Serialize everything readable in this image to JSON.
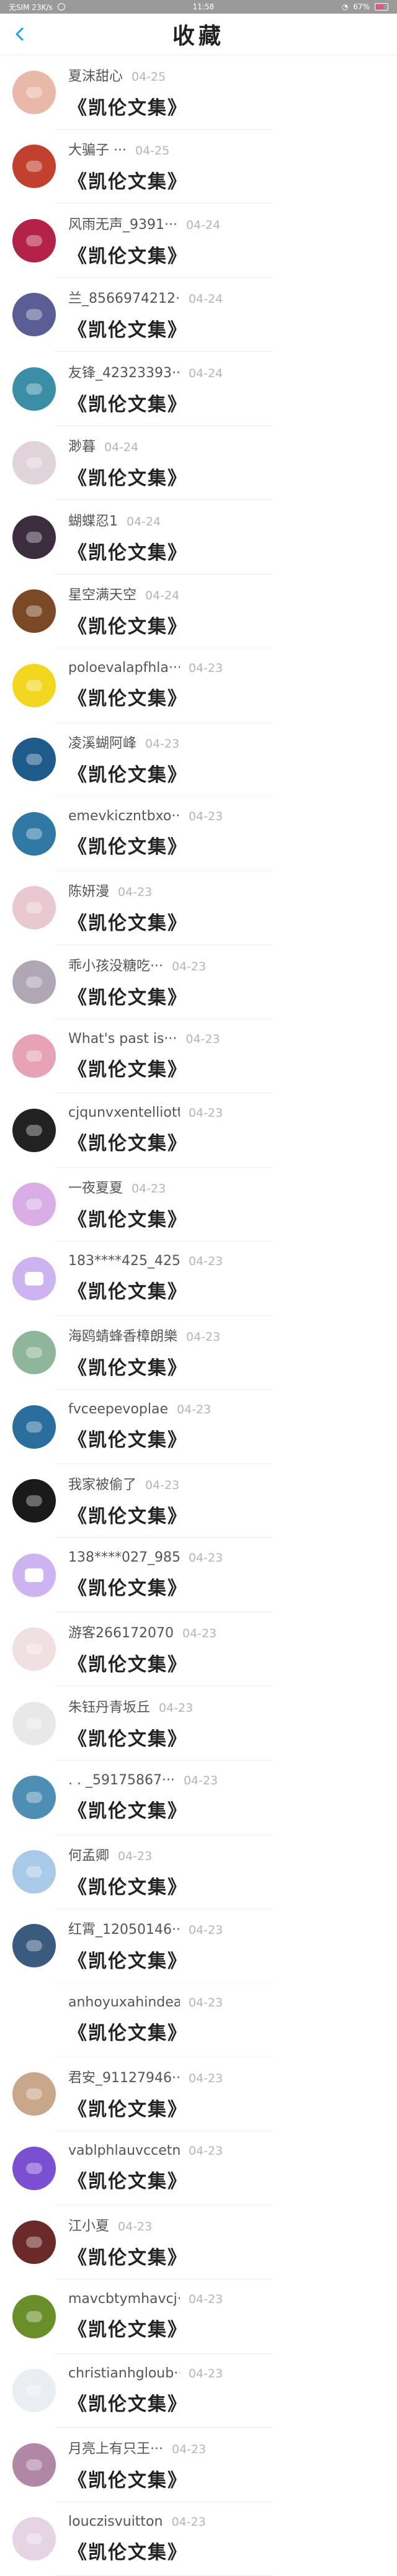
{
  "status_bar": {
    "left": "无SIM 23K/s",
    "time": "11:58",
    "right": "67%"
  },
  "header": {
    "title": "收藏"
  },
  "colors": {
    "accent": "#1aa0e6"
  },
  "items": [
    {
      "user": "夏沫甜心",
      "date": "04-25",
      "book": "《凯伦文集》",
      "color": "#e8b8a8"
    },
    {
      "user": "大骗子 ···",
      "date": "04-25",
      "book": "《凯伦文集》",
      "color": "#c2412e"
    },
    {
      "user": "风雨无声_9391···",
      "date": "04-24",
      "book": "《凯伦文集》",
      "color": "#b4224a"
    },
    {
      "user": "兰_8566974212···",
      "date": "04-24",
      "book": "《凯伦文集》",
      "color": "#5a5e95"
    },
    {
      "user": "友锋_42323393···",
      "date": "04-24",
      "book": "《凯伦文集》",
      "color": "#3a8ea6"
    },
    {
      "user": "渺暮",
      "date": "04-24",
      "book": "《凯伦文集》",
      "color": "#e0d3d9"
    },
    {
      "user": "蝴蝶忍1",
      "date": "04-24",
      "book": "《凯伦文集》",
      "color": "#3b2d3e"
    },
    {
      "user": "星空满天空",
      "date": "04-24",
      "book": "《凯伦文集》",
      "color": "#7a4a26"
    },
    {
      "user": "poloevalapfhla···",
      "date": "04-23",
      "book": "《凯伦文集》",
      "color": "#f3d620"
    },
    {
      "user": "凌溪蝴阿峰",
      "date": "04-23",
      "book": "《凯伦文集》",
      "color": "#1e5a8a"
    },
    {
      "user": "emevkiczntbxo···",
      "date": "04-23",
      "book": "《凯伦文集》",
      "color": "#2f79a4"
    },
    {
      "user": "陈妍漫",
      "date": "04-23",
      "book": "《凯伦文集》",
      "color": "#e9c9cf"
    },
    {
      "user": "乖小孩没糖吃···",
      "date": "04-23",
      "book": "《凯伦文集》",
      "color": "#b0a6b4"
    },
    {
      "user": "What's past is···",
      "date": "04-23",
      "book": "《凯伦文集》",
      "color": "#e6a3b5"
    },
    {
      "user": "cjqunvxentelliott",
      "date": "04-23",
      "book": "《凯伦文集》",
      "color": "#222222"
    },
    {
      "user": "一夜夏夏",
      "date": "04-23",
      "book": "《凯伦文集》",
      "color": "#d9aee6"
    },
    {
      "user": "183****425_425···",
      "date": "04-23",
      "book": "《凯伦文集》",
      "color": "#cbb4f0",
      "speech": true
    },
    {
      "user": "海鸥蜻蜂香樟朗樂",
      "date": "04-23",
      "book": "《凯伦文集》",
      "color": "#8fb59a"
    },
    {
      "user": "fvceepevoplae",
      "date": "04-23",
      "book": "《凯伦文集》",
      "color": "#2a6e9e"
    },
    {
      "user": "我家被偷了",
      "date": "04-23",
      "book": "《凯伦文集》",
      "color": "#1a1a1a"
    },
    {
      "user": "138****027_985···",
      "date": "04-23",
      "book": "《凯伦文集》",
      "color": "#cbb4f0",
      "speech": true
    },
    {
      "user": "游客266172070",
      "date": "04-23",
      "book": "《凯伦文集》",
      "color": "#f0e0e0"
    },
    {
      "user": "朱钰丹青坂丘",
      "date": "04-23",
      "book": "《凯伦文集》",
      "color": "#e8e8e8"
    },
    {
      "user": ". . _59175867···",
      "date": "04-23",
      "book": "《凯伦文集》",
      "color": "#4f8eb4"
    },
    {
      "user": "何孟卿",
      "date": "04-23",
      "book": "《凯伦文集》",
      "color": "#a9c9e9"
    },
    {
      "user": "红霄_12050146···",
      "date": "04-23",
      "book": "《凯伦文集》",
      "color": "#3a5a7e"
    },
    {
      "user": "anhoyuxahindea···",
      "date": "04-23",
      "book": "《凯伦文集》",
      "color": "#ffffff"
    },
    {
      "user": "君安_91127946···",
      "date": "04-23",
      "book": "《凯伦文集》",
      "color": "#c9a78a"
    },
    {
      "user": "vablphlauvccetnd",
      "date": "04-23",
      "book": "《凯伦文集》",
      "color": "#7a4fd0"
    },
    {
      "user": "江小夏",
      "date": "04-23",
      "book": "《凯伦文集》",
      "color": "#6a2a2a"
    },
    {
      "user": "mavcbtymhavcj···",
      "date": "04-23",
      "book": "《凯伦文集》",
      "color": "#6a8e2a"
    },
    {
      "user": "christianhgloub···",
      "date": "04-23",
      "book": "《凯伦文集》",
      "color": "#e8eef2"
    },
    {
      "user": "月亮上有只王···",
      "date": "04-23",
      "book": "《凯伦文集》",
      "color": "#b088a6"
    },
    {
      "user": "louczisvuitton",
      "date": "04-23",
      "book": "《凯伦文集》",
      "color": "#e4d4e4"
    }
  ]
}
